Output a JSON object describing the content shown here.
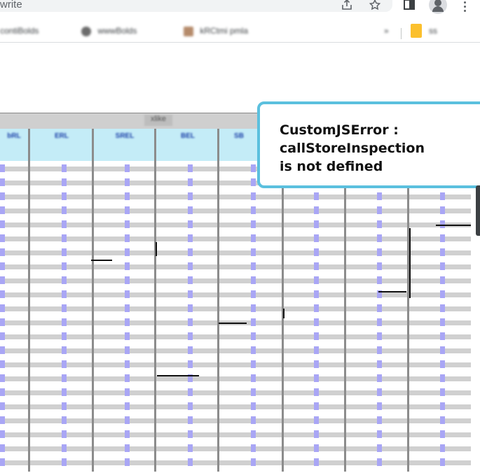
{
  "browser": {
    "url_fragment": "write",
    "toolbar_icons": [
      "share-icon",
      "star-icon",
      "sidepanel-icon",
      "profile-icon",
      "menu-icon"
    ],
    "bookmarks": [
      {
        "label": "contiBolds",
        "icon": "bookmark-favicon",
        "color": "#8d8d8d"
      },
      {
        "label": "wwwBolds",
        "icon": "gear-icon",
        "color": "#6b6b6b"
      },
      {
        "label": "kRCtmi pmla",
        "icon": "image-favicon",
        "color": "#b58b6b"
      },
      {
        "label": "ss",
        "icon": "folder-icon",
        "color": "#fbc02d"
      }
    ]
  },
  "grid": {
    "title": "xlike",
    "headers": [
      "bRL",
      "ERL",
      "SREL",
      "BEL",
      "BEL",
      "SB"
    ],
    "row_count": 22
  },
  "error": {
    "line1": "CustomJSError :",
    "line2": "callStoreInspection",
    "line3": "is not defined",
    "accent": "#5bc0de"
  }
}
